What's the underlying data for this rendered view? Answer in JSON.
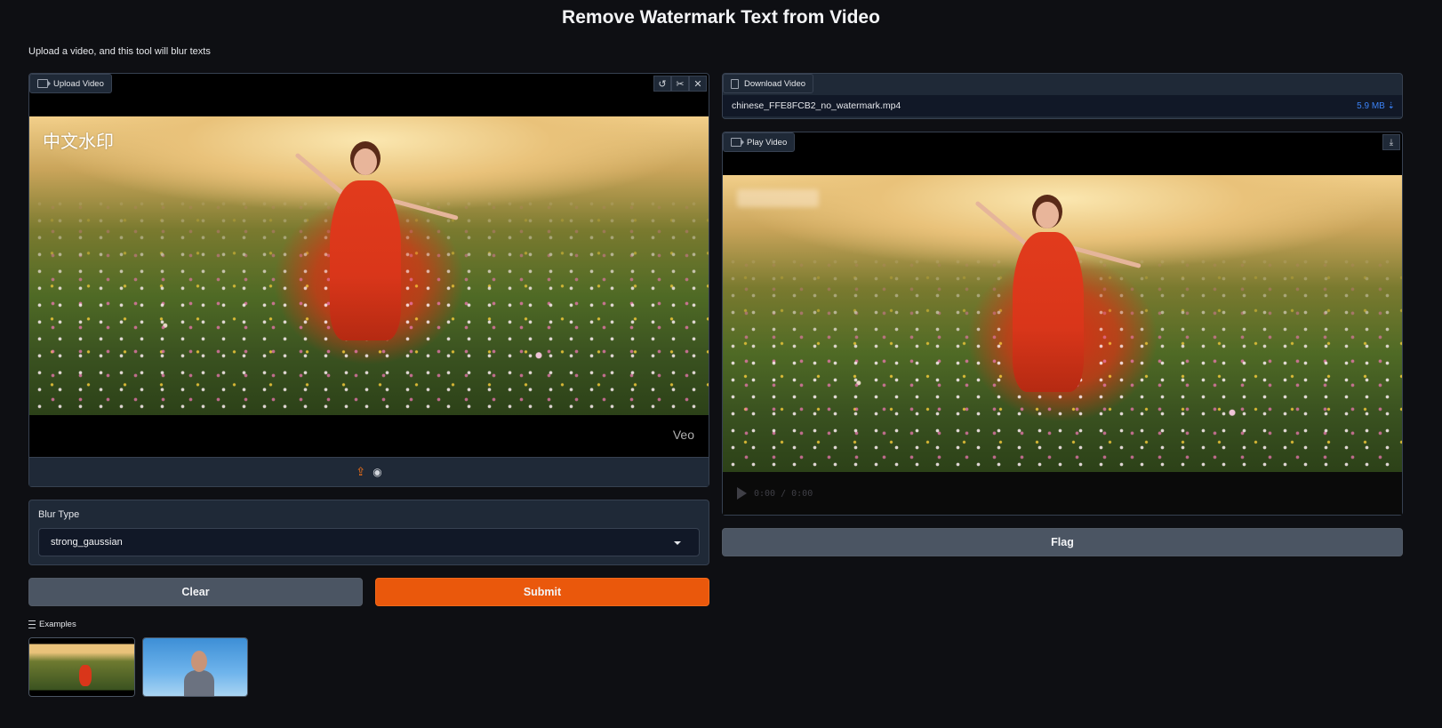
{
  "header": {
    "title": "Remove Watermark Text from Video",
    "subtitle": "Upload a video, and this tool will blur texts"
  },
  "upload_panel": {
    "label": "Upload Video",
    "watermark_cn": "中文水印",
    "watermark_veo": "Veo",
    "tools": [
      "↺",
      "✂",
      "✕"
    ]
  },
  "blur": {
    "label": "Blur Type",
    "selected": "strong_gaussian"
  },
  "buttons": {
    "clear": "Clear",
    "submit": "Submit",
    "flag": "Flag"
  },
  "examples": {
    "label": "Examples"
  },
  "download_panel": {
    "label": "Download Video",
    "file_name": "chinese_FFE8FCB2_no_watermark.mp4",
    "file_size": "5.9 MB ⇣"
  },
  "play_panel": {
    "label": "Play Video",
    "time": "0:00 / 0:00"
  },
  "colors": {
    "accent": "#ea580c",
    "background": "#0e0f13",
    "link": "#3b82f6"
  }
}
